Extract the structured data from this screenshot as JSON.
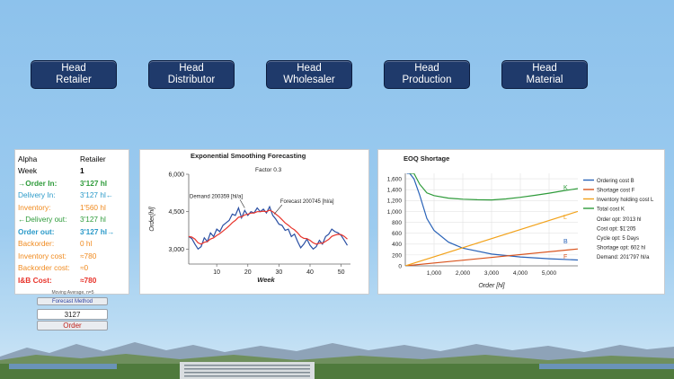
{
  "nav": [
    {
      "line1": "Head",
      "line2": "Retailer"
    },
    {
      "line1": "Head",
      "line2": "Distributor"
    },
    {
      "line1": "Head",
      "line2": "Wholesaler"
    },
    {
      "line1": "Head",
      "line2": "Production"
    },
    {
      "line1": "Head",
      "line2": "Material"
    }
  ],
  "stats": {
    "header_left": "Alpha",
    "header_right": "Retailer",
    "rows": [
      {
        "label": "Week",
        "value": "1",
        "color": "#000000"
      },
      {
        "label": "→Order In:",
        "value": "3'127 hl",
        "color": "#2e9b3a"
      },
      {
        "label": "Delivery In:",
        "value": "3'127 hl←",
        "color": "#2b9ac9"
      },
      {
        "label": "Inventory:",
        "value": "1'560 hl",
        "color": "#f08a1e"
      },
      {
        "label": "←Delivery out:",
        "value": "3'127 hl",
        "color": "#2e9b3a"
      },
      {
        "label": "Order out:",
        "value": "3'127 hl→",
        "color": "#2b9ac9"
      },
      {
        "label": "Backorder:",
        "value": "0 hl",
        "color": "#f08a1e"
      },
      {
        "label": "Inventory cost:",
        "value": "≈780",
        "color": "#f08a1e"
      },
      {
        "label": "Backorder cost:",
        "value": "≈0",
        "color": "#f08a1e"
      },
      {
        "label": "I&B Cost:",
        "value": "≈780",
        "color": "#e8342b"
      }
    ]
  },
  "controls": {
    "moving_average_label": "Moving Average, n=5",
    "forecast_method": "Forecast Method",
    "order_value": "3127",
    "order_button": "Order"
  },
  "chart_data": [
    {
      "type": "line",
      "title": "Exponential Smoothing Forecasting",
      "subtitle": "Factor 0.3",
      "xlabel": "Week",
      "ylabel": "Order[hl]",
      "xticks": [
        "10",
        "20",
        "30",
        "40",
        "50"
      ],
      "yticks": [
        "3,000",
        "4,500",
        "6,000"
      ],
      "xlim": [
        1,
        53
      ],
      "ylim": [
        2400,
        6000
      ],
      "series": [
        {
          "name": "Demand",
          "color": "#2a4fa3",
          "x": [
            1,
            2,
            3,
            4,
            5,
            6,
            7,
            8,
            9,
            10,
            11,
            12,
            13,
            14,
            15,
            16,
            17,
            18,
            19,
            20,
            21,
            22,
            23,
            24,
            25,
            26,
            27,
            28,
            29,
            30,
            31,
            32,
            33,
            34,
            35,
            36,
            37,
            38,
            39,
            40,
            41,
            42,
            43,
            44,
            45,
            46,
            47,
            48,
            49,
            50,
            51,
            52
          ],
          "values": [
            3500,
            3420,
            3200,
            3000,
            3100,
            3450,
            3300,
            3650,
            3500,
            3800,
            3700,
            3950,
            4050,
            4150,
            4400,
            4350,
            4650,
            4250,
            4550,
            4350,
            4500,
            4450,
            4650,
            4500,
            4600,
            4450,
            4700,
            4350,
            4200,
            4000,
            3950,
            3750,
            3800,
            3500,
            3600,
            3300,
            3050,
            3200,
            3400,
            3150,
            3000,
            3100,
            3350,
            3200,
            3500,
            3600,
            3800,
            3700,
            3650,
            3550,
            3350,
            3150
          ]
        },
        {
          "name": "Forecast",
          "color": "#e8342b",
          "x": [
            1,
            2,
            3,
            4,
            5,
            6,
            7,
            8,
            9,
            10,
            11,
            12,
            13,
            14,
            15,
            16,
            17,
            18,
            19,
            20,
            21,
            22,
            23,
            24,
            25,
            26,
            27,
            28,
            29,
            30,
            31,
            32,
            33,
            34,
            35,
            36,
            37,
            38,
            39,
            40,
            41,
            42,
            43,
            44,
            45,
            46,
            47,
            48,
            49,
            50,
            51,
            52
          ],
          "values": [
            3500,
            3480,
            3400,
            3250,
            3200,
            3270,
            3300,
            3400,
            3450,
            3550,
            3620,
            3720,
            3820,
            3930,
            4060,
            4150,
            4280,
            4290,
            4370,
            4400,
            4440,
            4450,
            4500,
            4500,
            4520,
            4500,
            4560,
            4500,
            4400,
            4300,
            4180,
            4050,
            3960,
            3850,
            3770,
            3650,
            3500,
            3430,
            3420,
            3350,
            3250,
            3200,
            3240,
            3230,
            3310,
            3390,
            3510,
            3560,
            3590,
            3580,
            3510,
            3400
          ]
        }
      ],
      "annotations": [
        {
          "text": "Demand 200359 [hl/a]",
          "x": 14,
          "y": 5050
        },
        {
          "text": "Forecast 200745 [hl/a]",
          "x": 31,
          "y": 4700
        }
      ],
      "grid": false
    },
    {
      "type": "line",
      "title": "EOQ Shortage",
      "xlabel": "Order [hl]",
      "ylabel": "",
      "xticks": [
        "1,000",
        "2,000",
        "3,000",
        "4,000",
        "5,000"
      ],
      "yticks": [
        "0",
        "200",
        "400",
        "600",
        "800",
        "1,000",
        "1,200",
        "1,400",
        "1,600"
      ],
      "xlim": [
        0,
        6000
      ],
      "ylim": [
        0,
        1700
      ],
      "grid": true,
      "legend_position": "right",
      "series": [
        {
          "name": "Ordering cost B",
          "short": "B",
          "color": "#2a63b8",
          "x": [
            50,
            150,
            300,
            500,
            750,
            1000,
            1500,
            2000,
            3000,
            4000,
            5000,
            6000
          ],
          "values": [
            1700,
            1700,
            1600,
            1300,
            870,
            650,
            435,
            325,
            217,
            163,
            130,
            108
          ]
        },
        {
          "name": "Shortage cost F",
          "short": "F",
          "color": "#d9541e",
          "x": [
            0,
            6000
          ],
          "values": [
            0,
            310
          ]
        },
        {
          "name": "Inventory holding cost L",
          "short": "L",
          "color": "#f2a21a",
          "x": [
            0,
            6000
          ],
          "values": [
            0,
            1000
          ]
        },
        {
          "name": "Total cost K",
          "short": "K",
          "color": "#2e9b3a",
          "x": [
            150,
            300,
            500,
            750,
            1000,
            1500,
            2000,
            2500,
            3000,
            3500,
            4000,
            4500,
            5000,
            5500,
            6000
          ],
          "values": [
            1700,
            1700,
            1500,
            1340,
            1290,
            1245,
            1225,
            1215,
            1212,
            1230,
            1260,
            1295,
            1335,
            1380,
            1420
          ]
        }
      ],
      "info": [
        "Order opt: 3'013 hl",
        "Cost opt: $1'205",
        "Cycle opt: 5 Days",
        "Shortage opt: 602 hl",
        "Demand: 201'797 hl/a"
      ]
    }
  ]
}
